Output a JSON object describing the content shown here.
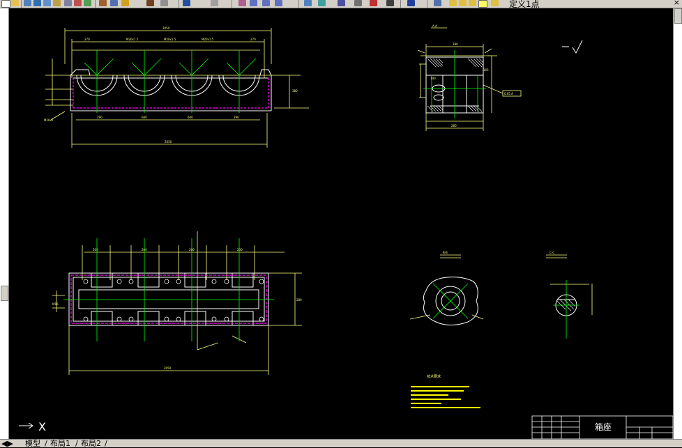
{
  "toolbar": {
    "named_view_label": "定义1点",
    "close_glyph": "×"
  },
  "tabs": {
    "model": "模型",
    "layout1": "布局1",
    "layout2": "布局2"
  },
  "ucs": {
    "x_label": "X"
  },
  "drawing": {
    "title_block_name": "箱座",
    "section_a_label": "A-A",
    "section_b_label": "B-B",
    "section_c_label": "C-C",
    "notes_heading": "技术要求",
    "colors": {
      "background": "#000000",
      "outline": "#ffffff",
      "dimension": "#ffff80",
      "center": "#00ff00",
      "hidden": "#ff00ff",
      "yellow_text": "#ffff00"
    }
  }
}
